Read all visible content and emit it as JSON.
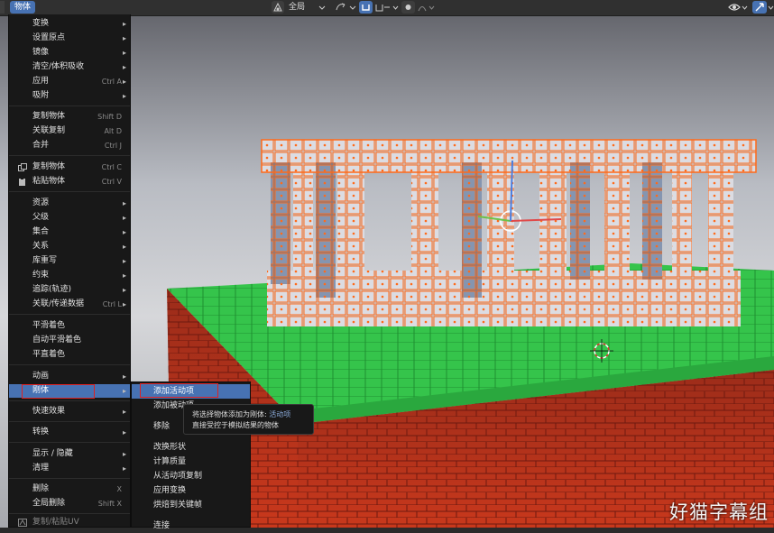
{
  "header": {
    "active_menu": "物体",
    "pivot_label": "全局"
  },
  "object_menu": {
    "items": [
      {
        "label": "变换",
        "submenu": true
      },
      {
        "label": "设置原点",
        "submenu": true
      },
      {
        "label": "镜像",
        "submenu": true
      },
      {
        "label": "清空/体积吸收",
        "submenu": true
      },
      {
        "label": "应用",
        "shortcut": "Ctrl A",
        "submenu": true
      },
      {
        "label": "吸附",
        "submenu": true
      },
      {
        "label": "复制物体",
        "shortcut": "Shift D"
      },
      {
        "label": "关联复制",
        "shortcut": "Alt D"
      },
      {
        "label": "合并",
        "shortcut": "Ctrl J"
      },
      {
        "label": "复制物体",
        "shortcut": "Ctrl C",
        "icon": "copy-icon"
      },
      {
        "label": "粘贴物体",
        "shortcut": "Ctrl V",
        "icon": "paste-icon"
      },
      {
        "label": "资源",
        "submenu": true
      },
      {
        "label": "父级",
        "submenu": true
      },
      {
        "label": "集合",
        "submenu": true
      },
      {
        "label": "关系",
        "submenu": true
      },
      {
        "label": "库重写",
        "submenu": true
      },
      {
        "label": "约束",
        "submenu": true
      },
      {
        "label": "追踪(轨迹)",
        "submenu": true
      },
      {
        "label": "关联/传递数据",
        "shortcut": "Ctrl L",
        "submenu": true
      },
      {
        "label": "平滑着色"
      },
      {
        "label": "自动平滑着色"
      },
      {
        "label": "平直着色"
      },
      {
        "label": "动画",
        "submenu": true
      },
      {
        "label": "刚体",
        "submenu": true,
        "active": true
      },
      {
        "label": "快速效果",
        "submenu": true
      },
      {
        "label": "转换",
        "submenu": true
      },
      {
        "label": "显示 / 隐藏",
        "submenu": true
      },
      {
        "label": "清理",
        "submenu": true
      },
      {
        "label": "删除",
        "shortcut": "X"
      },
      {
        "label": "全局删除",
        "shortcut": "Shift X"
      },
      {
        "label": "复制/粘贴UV",
        "icon": "uv-icon"
      }
    ]
  },
  "rigid_body_menu": {
    "items": [
      {
        "label": "添加活动项",
        "active": true
      },
      {
        "label": "添加被动项"
      },
      {
        "label": "移除"
      },
      {
        "label": "改换形状"
      },
      {
        "label": "计算质量"
      },
      {
        "label": "从活动项复制"
      },
      {
        "label": "应用变换"
      },
      {
        "label": "烘焙到关键帧"
      },
      {
        "label": "连接"
      }
    ]
  },
  "tooltip": {
    "line1": "将选择物体添加为刚体:",
    "line1_highlight": "活动项",
    "line2": "直接受控于模拟结果的物体"
  },
  "watermark": "好猫字幕组",
  "colors": {
    "menu_bg": "#181818",
    "active": "#4772b3",
    "highlight_box": "#dd2222",
    "selection_outline": "#ff6a1a",
    "grass": "#33c24a",
    "brick": "#b8321c"
  }
}
